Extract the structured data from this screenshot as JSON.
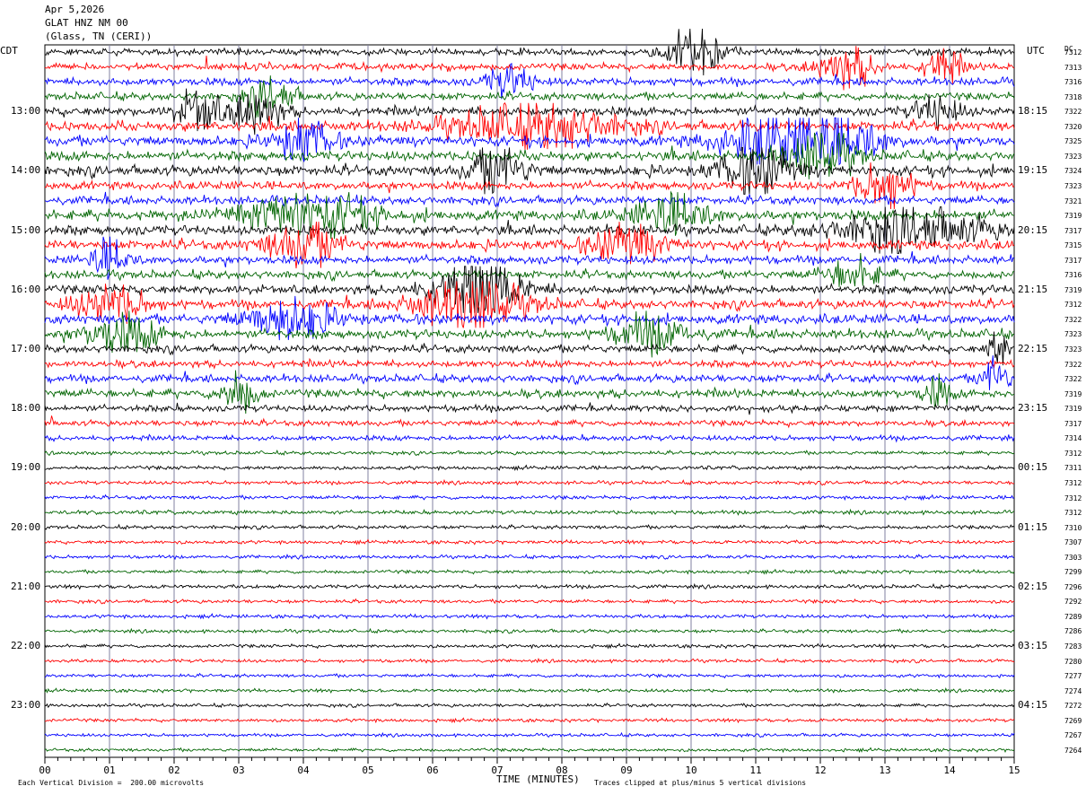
{
  "header": {
    "date": "Apr 5,2026",
    "station": "GLAT HNZ NM 00",
    "location": "(Glass, TN (CERI))"
  },
  "left_axis_title": "CDT",
  "right_axis_title": "UTC",
  "dc_title": "DC",
  "footer": {
    "scale_note": "Each Vertical Division =  200.00 microvolts",
    "clip_note": "Traces clipped at plus/minus 5 vertical divisions"
  },
  "colors": {
    "trace_cycle": [
      "#000000",
      "#ff0000",
      "#0000ff",
      "#006400"
    ],
    "grid_vertical": "#8080a0",
    "frame": "#000000"
  },
  "chart_data": {
    "type": "line",
    "title": "",
    "xlabel": "TIME (MINUTES)",
    "ylabel": "",
    "xlim": [
      0,
      15
    ],
    "x_ticks": [
      "00",
      "01",
      "02",
      "03",
      "04",
      "05",
      "06",
      "07",
      "08",
      "09",
      "10",
      "11",
      "12",
      "13",
      "14",
      "15"
    ],
    "rows": 48,
    "row_minutes": 15,
    "left_hour_labels": [
      "13:00",
      "14:00",
      "15:00",
      "16:00",
      "17:00",
      "18:00",
      "19:00",
      "20:00",
      "21:00",
      "22:00",
      "23:00"
    ],
    "right_hour_labels": [
      "18:15",
      "19:15",
      "20:15",
      "21:15",
      "22:15",
      "23:15",
      "00:15",
      "01:15",
      "02:15",
      "03:15",
      "04:15"
    ],
    "dc_offsets": [
      "7312",
      "7313",
      "7316",
      "7318",
      "7322",
      "7320",
      "7325",
      "7323",
      "7324",
      "7323",
      "7321",
      "7319",
      "7317",
      "7315",
      "7317",
      "7316",
      "7319",
      "7312",
      "7322",
      "7323",
      "7323",
      "7322",
      "7322",
      "7319",
      "7319",
      "7317",
      "7314",
      "7312",
      "7311",
      "7312",
      "7312",
      "7312",
      "7310",
      "7307",
      "7303",
      "7299",
      "7296",
      "7292",
      "7289",
      "7286",
      "7283",
      "7280",
      "7277",
      "7274",
      "7272",
      "7269",
      "7267",
      "7264"
    ],
    "row_activity": [
      0.3,
      0.35,
      0.4,
      0.4,
      0.5,
      0.55,
      0.6,
      0.55,
      0.6,
      0.45,
      0.45,
      0.6,
      0.55,
      0.55,
      0.45,
      0.45,
      0.5,
      0.5,
      0.55,
      0.5,
      0.4,
      0.35,
      0.4,
      0.45,
      0.3,
      0.25,
      0.2,
      0.08,
      0.08,
      0.08,
      0.08,
      0.1,
      0.08,
      0.07,
      0.06,
      0.06,
      0.08,
      0.07,
      0.07,
      0.06,
      0.06,
      0.05,
      0.05,
      0.05,
      0.05,
      0.05,
      0.04,
      0.04
    ],
    "events": [
      {
        "row": 0,
        "minute": 10.1,
        "amp": 1.8,
        "width": 0.6
      },
      {
        "row": 1,
        "minute": 12.4,
        "amp": 1.4,
        "width": 0.6
      },
      {
        "row": 1,
        "minute": 13.9,
        "amp": 1.2,
        "width": 0.4
      },
      {
        "row": 2,
        "minute": 7.2,
        "amp": 1.0,
        "width": 0.5
      },
      {
        "row": 3,
        "minute": 3.5,
        "amp": 1.2,
        "width": 0.5
      },
      {
        "row": 4,
        "minute": 2.4,
        "amp": 1.5,
        "width": 0.5
      },
      {
        "row": 4,
        "minute": 3.3,
        "amp": 1.5,
        "width": 0.5
      },
      {
        "row": 4,
        "minute": 13.8,
        "amp": 1.0,
        "width": 0.5
      },
      {
        "row": 5,
        "minute": 7.6,
        "amp": 1.4,
        "width": 1.8
      },
      {
        "row": 6,
        "minute": 4.0,
        "amp": 1.4,
        "width": 0.6
      },
      {
        "row": 6,
        "minute": 11.3,
        "amp": 1.6,
        "width": 1.2
      },
      {
        "row": 6,
        "minute": 12.4,
        "amp": 1.4,
        "width": 0.8
      },
      {
        "row": 7,
        "minute": 12.0,
        "amp": 1.5,
        "width": 0.8
      },
      {
        "row": 8,
        "minute": 7.0,
        "amp": 1.6,
        "width": 0.6
      },
      {
        "row": 8,
        "minute": 11.0,
        "amp": 1.6,
        "width": 0.8
      },
      {
        "row": 9,
        "minute": 13.0,
        "amp": 1.6,
        "width": 0.6
      },
      {
        "row": 11,
        "minute": 4.1,
        "amp": 1.5,
        "width": 1.4
      },
      {
        "row": 11,
        "minute": 9.7,
        "amp": 1.2,
        "width": 0.8
      },
      {
        "row": 12,
        "minute": 13.4,
        "amp": 1.4,
        "width": 1.6
      },
      {
        "row": 13,
        "minute": 4.0,
        "amp": 1.4,
        "width": 0.8
      },
      {
        "row": 13,
        "minute": 9.0,
        "amp": 1.2,
        "width": 0.8
      },
      {
        "row": 14,
        "minute": 1.0,
        "amp": 1.2,
        "width": 0.4
      },
      {
        "row": 15,
        "minute": 12.5,
        "amp": 1.0,
        "width": 0.6
      },
      {
        "row": 16,
        "minute": 6.7,
        "amp": 1.9,
        "width": 1.0
      },
      {
        "row": 17,
        "minute": 6.6,
        "amp": 1.7,
        "width": 1.2
      },
      {
        "row": 17,
        "minute": 1.0,
        "amp": 1.2,
        "width": 0.8
      },
      {
        "row": 18,
        "minute": 3.8,
        "amp": 1.2,
        "width": 1.0
      },
      {
        "row": 19,
        "minute": 9.4,
        "amp": 1.2,
        "width": 0.8
      },
      {
        "row": 19,
        "minute": 1.2,
        "amp": 1.2,
        "width": 0.8
      },
      {
        "row": 20,
        "minute": 14.75,
        "amp": 1.5,
        "width": 0.2
      },
      {
        "row": 22,
        "minute": 14.7,
        "amp": 1.4,
        "width": 0.3
      },
      {
        "row": 23,
        "minute": 3.0,
        "amp": 1.3,
        "width": 0.4
      },
      {
        "row": 23,
        "minute": 13.8,
        "amp": 1.0,
        "width": 0.3
      }
    ]
  }
}
